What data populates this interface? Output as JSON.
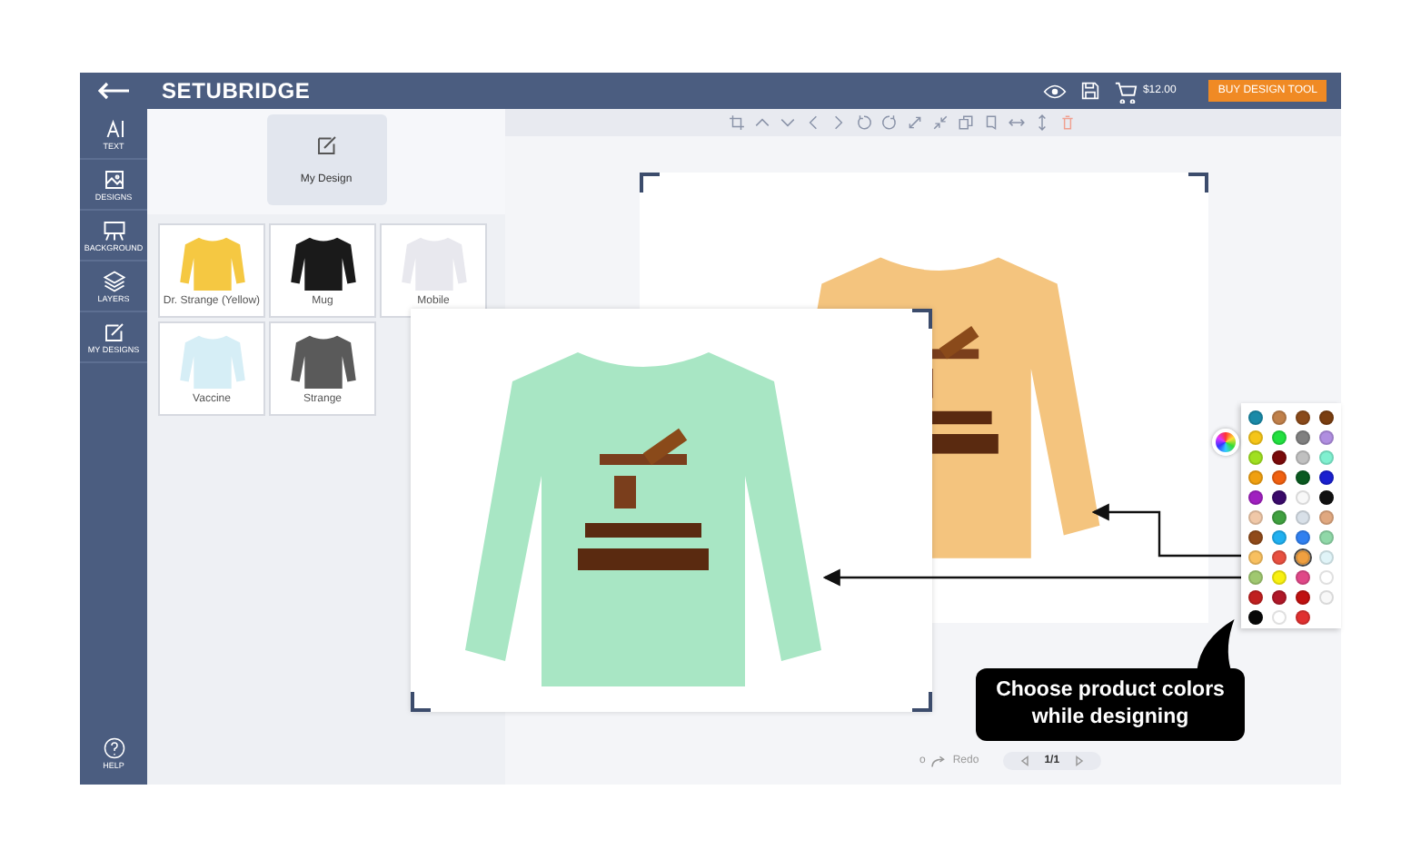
{
  "header": {
    "brand": "SETUBRIDGE",
    "price": "$12.00",
    "buy_button": "BUY DESIGN TOOL"
  },
  "sidebar": {
    "items": [
      {
        "kind": "text",
        "label": "TEXT"
      },
      {
        "kind": "designs",
        "label": "DESIGNS"
      },
      {
        "kind": "background",
        "label": "BACKGROUND"
      },
      {
        "kind": "layers",
        "label": "LAYERS"
      },
      {
        "kind": "mydesigns",
        "label": "MY DESIGNS"
      }
    ],
    "help": "HELP"
  },
  "panel": {
    "tab": {
      "label": "My Design",
      "selected": true
    },
    "products": [
      {
        "name": "Dr. Strange (Yellow)",
        "color": "#f5c842"
      },
      {
        "name": "Mug",
        "color": "#1a1a1a"
      },
      {
        "name": "Mobile",
        "color": "#e8e8ee"
      },
      {
        "name": "Vaccine",
        "color": "#d6eef6"
      },
      {
        "name": "Strange",
        "color": "#5a5a5a"
      }
    ]
  },
  "canvas": {
    "undo": "o",
    "redo": "Redo",
    "page": "1/1"
  },
  "palette": {
    "swatches": [
      {
        "color": "#1a8aa8",
        "selected": false
      },
      {
        "color": "#c0804a",
        "selected": false
      },
      {
        "color": "#8a4a1a",
        "selected": false
      },
      {
        "color": "#7a3e10",
        "selected": false
      },
      {
        "color": "#f5c518",
        "selected": false
      },
      {
        "color": "#22e040",
        "selected": false
      },
      {
        "color": "#808080",
        "selected": false
      },
      {
        "color": "#b08ee0",
        "selected": false
      },
      {
        "color": "#a0e020",
        "selected": false
      },
      {
        "color": "#7a0a0a",
        "selected": false
      },
      {
        "color": "#c0c0c0",
        "selected": false
      },
      {
        "color": "#80f0d0",
        "selected": false
      },
      {
        "color": "#f0a010",
        "selected": false
      },
      {
        "color": "#f06010",
        "selected": false
      },
      {
        "color": "#0a5a20",
        "selected": false
      },
      {
        "color": "#1a20d0",
        "selected": false
      },
      {
        "color": "#a020c0",
        "selected": false
      },
      {
        "color": "#3a0a6a",
        "selected": false
      },
      {
        "color": "#f8f8f8",
        "selected": false
      },
      {
        "color": "#101010",
        "selected": false
      },
      {
        "color": "#f0c8a8",
        "selected": false
      },
      {
        "color": "#40a040",
        "selected": false
      },
      {
        "color": "#d8e0e8",
        "selected": false
      },
      {
        "color": "#e0a880",
        "selected": false
      },
      {
        "color": "#904a1a",
        "selected": false
      },
      {
        "color": "#20b0f0",
        "selected": false
      },
      {
        "color": "#3080f0",
        "selected": false
      },
      {
        "color": "#90d8a8",
        "selected": false
      },
      {
        "color": "#f8c060",
        "selected": false
      },
      {
        "color": "#e85040",
        "selected": false
      },
      {
        "color": "#f0a040",
        "selected": true
      },
      {
        "color": "#e0f4f8",
        "selected": false
      },
      {
        "color": "#a0c870",
        "selected": false
      },
      {
        "color": "#f8f010",
        "selected": false
      },
      {
        "color": "#e04888",
        "selected": false
      },
      {
        "color": "#ffffff",
        "selected": false
      },
      {
        "color": "#c02020",
        "selected": false
      },
      {
        "color": "#b01828",
        "selected": false
      },
      {
        "color": "#c01010",
        "selected": false
      },
      {
        "color": "#f8f8f8",
        "selected": false
      },
      {
        "color": "#080808",
        "selected": false
      },
      {
        "color": "#ffffff",
        "selected": false
      },
      {
        "color": "#e03030",
        "selected": false
      }
    ]
  },
  "callout": "Choose product colors while designing"
}
